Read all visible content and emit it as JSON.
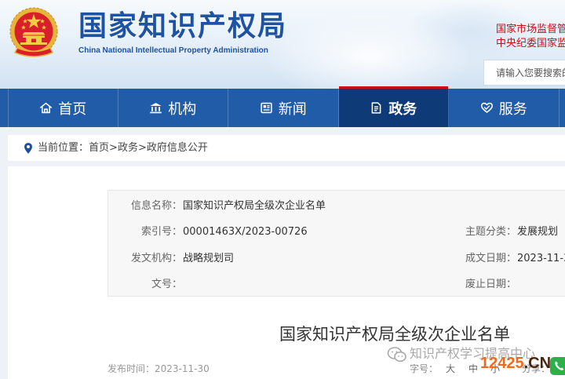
{
  "header": {
    "title_cn": "国家知识产权局",
    "title_en": "China National Intellectual Property Administration",
    "top_links": [
      "国家市场监督管",
      "中央纪委国家监"
    ],
    "search_placeholder": "请输入您要搜索的",
    "emblem_icon": "national-emblem-icon"
  },
  "nav": {
    "items": [
      {
        "label": "首页",
        "icon": "home-icon",
        "active": false
      },
      {
        "label": "机构",
        "icon": "building-icon",
        "active": false
      },
      {
        "label": "新闻",
        "icon": "newspaper-icon",
        "active": false
      },
      {
        "label": "政务",
        "icon": "document-icon",
        "active": true
      },
      {
        "label": "服务",
        "icon": "heart-service-icon",
        "active": false
      }
    ]
  },
  "breadcrumb": {
    "icon": "location-pin-icon",
    "label": "当前位置：",
    "separator": ">",
    "items": [
      "首页",
      "政务",
      "政府信息公开"
    ]
  },
  "info_table": {
    "rows": [
      {
        "label": "信息名称：",
        "value": "国家知识产权局全级次企业名单"
      },
      {
        "label": "索引号：",
        "value": "00001463X/2023-00726",
        "right_label": "主题分类：",
        "right_value": "发展规划"
      },
      {
        "label": "发文机构：",
        "value": "战略规划司",
        "right_label": "成文日期：",
        "right_value": "2023-11-3"
      },
      {
        "label": "文号：",
        "value": "",
        "right_label": "废止日期：",
        "right_value": ""
      }
    ]
  },
  "article": {
    "title": "国家知识产权局全级次企业名单",
    "publish_label": "发布时间：",
    "publish_date": "2023-11-30",
    "font_size_label": "字号：",
    "font_size_options": [
      "大",
      "中",
      "小"
    ],
    "share_label": "分享："
  },
  "watermarks": {
    "wechat_icon": "wechat-icon",
    "wechat_account": "知识产权学习提高中心",
    "site_number": "12425",
    "site_suffix": ".CN",
    "site_icon": "phone-service-icon"
  },
  "colors": {
    "brand_blue": "#1d53a2",
    "nav_background": "#215ca9",
    "nav_active": "#0f3a78",
    "accent_red": "#c4121b",
    "watermark_orange": "#ef6a1f",
    "watermark_green": "#2cb14a"
  }
}
